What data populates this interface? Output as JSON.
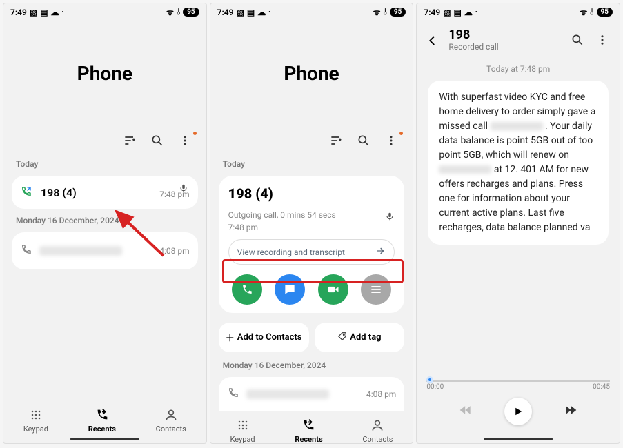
{
  "status": {
    "time": "7:49",
    "battery": "95"
  },
  "phone": {
    "title": "Phone",
    "today_label": "Today",
    "older_label": "Monday 16 December, 2024"
  },
  "call1": {
    "number": "198 (4)",
    "time": "7:48 pm"
  },
  "older_call": {
    "time": "4:08 pm"
  },
  "expanded": {
    "number": "198 (4)",
    "meta_line1": "Outgoing call, 0 mins 54 secs",
    "meta_line2": "7:48 pm",
    "view_rec_label": "View recording and transcript",
    "add_contacts": "Add to Contacts",
    "add_tag": "Add tag"
  },
  "nav": {
    "keypad": "Keypad",
    "recents": "Recents",
    "contacts": "Contacts"
  },
  "rc": {
    "name": "198",
    "sub": "Recorded call",
    "timestamp": "Today at 7:48 pm",
    "transcript_a": "With superfast video KYC and free home delivery to order simply gave a missed call",
    "transcript_b": ". Your daily data balance is point 5GB out of too point 5GB, which will renew on",
    "transcript_c": "at 12. 401 AM for new offers recharges and plans. Press one for information about your current active plans. Last five recharges, data balance planned va"
  },
  "player": {
    "start": "00:00",
    "end": "00:45"
  }
}
